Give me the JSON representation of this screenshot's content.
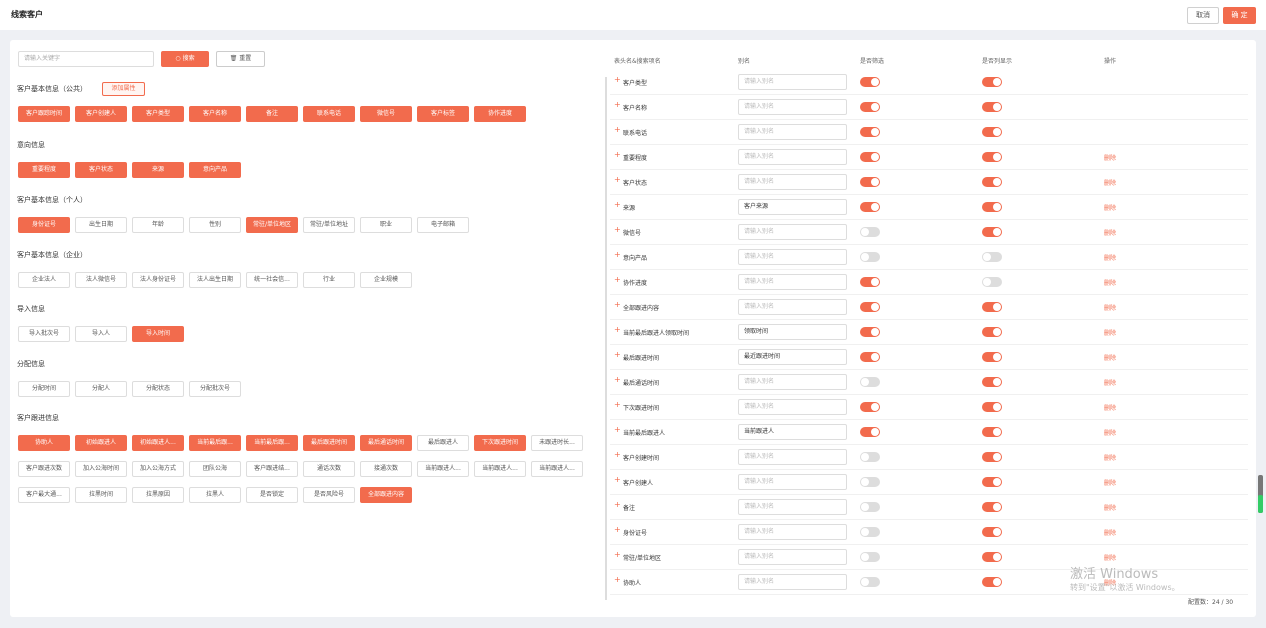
{
  "header": {
    "title": "线索客户",
    "cancel": "取消",
    "ok": "确 定"
  },
  "toolbar": {
    "search_placeholder": "请输入关键字",
    "search_btn": "搜索",
    "reset_btn": "重置"
  },
  "add_attr": "添加属性",
  "sections": [
    {
      "title": "客户基本信息（公共）",
      "rows": [
        [
          {
            "label": "客户跟踪时间",
            "on": true
          },
          {
            "label": "客户创建人",
            "on": true
          },
          {
            "label": "客户类型",
            "on": true
          },
          {
            "label": "客户名称",
            "on": true
          },
          {
            "label": "备注",
            "on": true
          },
          {
            "label": "联系电话",
            "on": true
          },
          {
            "label": "微信号",
            "on": true
          },
          {
            "label": "客户标签",
            "on": true
          },
          {
            "label": "协作进度",
            "on": true
          }
        ]
      ]
    },
    {
      "title": "意向信息",
      "rows": [
        [
          {
            "label": "重要程度",
            "on": true
          },
          {
            "label": "客户状态",
            "on": true
          },
          {
            "label": "来源",
            "on": true
          },
          {
            "label": "意向产品",
            "on": true
          }
        ]
      ]
    },
    {
      "title": "客户基本信息（个人）",
      "rows": [
        [
          {
            "label": "身份证号",
            "on": true
          },
          {
            "label": "出生日期",
            "on": false
          },
          {
            "label": "年龄",
            "on": false
          },
          {
            "label": "性别",
            "on": false
          },
          {
            "label": "常驻/单位地区",
            "on": true
          },
          {
            "label": "常驻/单位地址",
            "on": false
          },
          {
            "label": "职业",
            "on": false
          },
          {
            "label": "电子邮箱",
            "on": false
          }
        ]
      ]
    },
    {
      "title": "客户基本信息（企业）",
      "rows": [
        [
          {
            "label": "企业法人",
            "on": false
          },
          {
            "label": "法人微信号",
            "on": false
          },
          {
            "label": "法人身份证号",
            "on": false
          },
          {
            "label": "法人出生日期",
            "on": false
          },
          {
            "label": "统一社会信...",
            "on": false
          },
          {
            "label": "行业",
            "on": false
          },
          {
            "label": "企业规模",
            "on": false
          }
        ]
      ]
    },
    {
      "title": "导入信息",
      "rows": [
        [
          {
            "label": "导入批次号",
            "on": false
          },
          {
            "label": "导入人",
            "on": false
          },
          {
            "label": "导入时间",
            "on": true
          }
        ]
      ]
    },
    {
      "title": "分配信息",
      "rows": [
        [
          {
            "label": "分配时间",
            "on": false
          },
          {
            "label": "分配人",
            "on": false
          },
          {
            "label": "分配状态",
            "on": false
          },
          {
            "label": "分配批次号",
            "on": false
          }
        ]
      ]
    },
    {
      "title": "客户跟进信息",
      "rows": [
        [
          {
            "label": "协助人",
            "on": true
          },
          {
            "label": "初始跟进人",
            "on": true
          },
          {
            "label": "初始跟进人...",
            "on": true
          },
          {
            "label": "当前最后跟...",
            "on": true
          },
          {
            "label": "当前最后跟...",
            "on": true
          },
          {
            "label": "最后跟进时间",
            "on": true
          },
          {
            "label": "最后通话时间",
            "on": true
          },
          {
            "label": "最后跟进人",
            "on": false
          },
          {
            "label": "下次跟进时间",
            "on": true
          },
          {
            "label": "未跟进时长...",
            "on": false
          }
        ],
        [
          {
            "label": "客户跟进次数",
            "on": false
          },
          {
            "label": "加入公海时间",
            "on": false
          },
          {
            "label": "加入公海方式",
            "on": false
          },
          {
            "label": "团队公海",
            "on": false
          },
          {
            "label": "客户跟进结...",
            "on": false
          },
          {
            "label": "通话次数",
            "on": false
          },
          {
            "label": "接通次数",
            "on": false
          },
          {
            "label": "当前跟进人...",
            "on": false
          },
          {
            "label": "当前跟进人...",
            "on": false
          },
          {
            "label": "当前跟进人...",
            "on": false
          }
        ],
        [
          {
            "label": "客户最大通...",
            "on": false
          },
          {
            "label": "拉黑时间",
            "on": false
          },
          {
            "label": "拉黑原因",
            "on": false
          },
          {
            "label": "拉黑人",
            "on": false
          },
          {
            "label": "是否锁定",
            "on": false
          },
          {
            "label": "是否风险号",
            "on": false
          },
          {
            "label": "全部跟进内容",
            "on": true
          }
        ]
      ]
    }
  ],
  "table": {
    "headers": [
      "表头名&搜索项名",
      "别名",
      "是否筛选",
      "是否列显示",
      "操作"
    ],
    "delete_label": "删除",
    "rows": [
      {
        "name": "客户类型",
        "alias": "",
        "placeholder": "请输入别名",
        "filter": true,
        "show": true,
        "del": false
      },
      {
        "name": "客户名称",
        "alias": "",
        "placeholder": "请输入别名",
        "filter": true,
        "show": true,
        "del": false
      },
      {
        "name": "联系电话",
        "alias": "",
        "placeholder": "请输入别名",
        "filter": true,
        "show": true,
        "del": false
      },
      {
        "name": "重要程度",
        "alias": "",
        "placeholder": "请输入别名",
        "filter": true,
        "show": true,
        "del": true
      },
      {
        "name": "客户状态",
        "alias": "",
        "placeholder": "请输入别名",
        "filter": true,
        "show": true,
        "del": true
      },
      {
        "name": "来源",
        "alias": "客户来源",
        "placeholder": "请输入别名",
        "filter": true,
        "show": true,
        "del": true
      },
      {
        "name": "微信号",
        "alias": "",
        "placeholder": "请输入别名",
        "filter": false,
        "show": true,
        "del": true
      },
      {
        "name": "意向产品",
        "alias": "",
        "placeholder": "请输入别名",
        "filter": false,
        "show": false,
        "del": true
      },
      {
        "name": "协作进度",
        "alias": "",
        "placeholder": "请输入别名",
        "filter": true,
        "show": false,
        "del": true
      },
      {
        "name": "全部跟进内容",
        "alias": "",
        "placeholder": "请输入别名",
        "filter": true,
        "show": true,
        "del": true
      },
      {
        "name": "当前最后跟进人领取时间",
        "alias": "领取时间",
        "placeholder": "请输入别名",
        "filter": true,
        "show": true,
        "del": true
      },
      {
        "name": "最后跟进时间",
        "alias": "最近跟进时间",
        "placeholder": "请输入别名",
        "filter": true,
        "show": true,
        "del": true
      },
      {
        "name": "最后通话时间",
        "alias": "",
        "placeholder": "请输入别名",
        "filter": false,
        "show": true,
        "del": true
      },
      {
        "name": "下次跟进时间",
        "alias": "",
        "placeholder": "请输入别名",
        "filter": true,
        "show": true,
        "del": true
      },
      {
        "name": "当前最后跟进人",
        "alias": "当前跟进人",
        "placeholder": "请输入别名",
        "filter": true,
        "show": true,
        "del": true
      },
      {
        "name": "客户创建时间",
        "alias": "",
        "placeholder": "请输入别名",
        "filter": false,
        "show": true,
        "del": true
      },
      {
        "name": "客户创建人",
        "alias": "",
        "placeholder": "请输入别名",
        "filter": false,
        "show": true,
        "del": true
      },
      {
        "name": "备注",
        "alias": "",
        "placeholder": "请输入别名",
        "filter": false,
        "show": true,
        "del": true
      },
      {
        "name": "身份证号",
        "alias": "",
        "placeholder": "请输入别名",
        "filter": false,
        "show": true,
        "del": true
      },
      {
        "name": "常驻/单位地区",
        "alias": "",
        "placeholder": "请输入别名",
        "filter": false,
        "show": true,
        "del": true
      },
      {
        "name": "协助人",
        "alias": "",
        "placeholder": "请输入别名",
        "filter": false,
        "show": true,
        "del": true
      }
    ]
  },
  "count": "配置数：24 / 30",
  "watermark": {
    "line1": "激活 Windows",
    "line2": "转到\"设置\"以激活 Windows。"
  },
  "colors": {
    "accent": "#f26b4d"
  }
}
